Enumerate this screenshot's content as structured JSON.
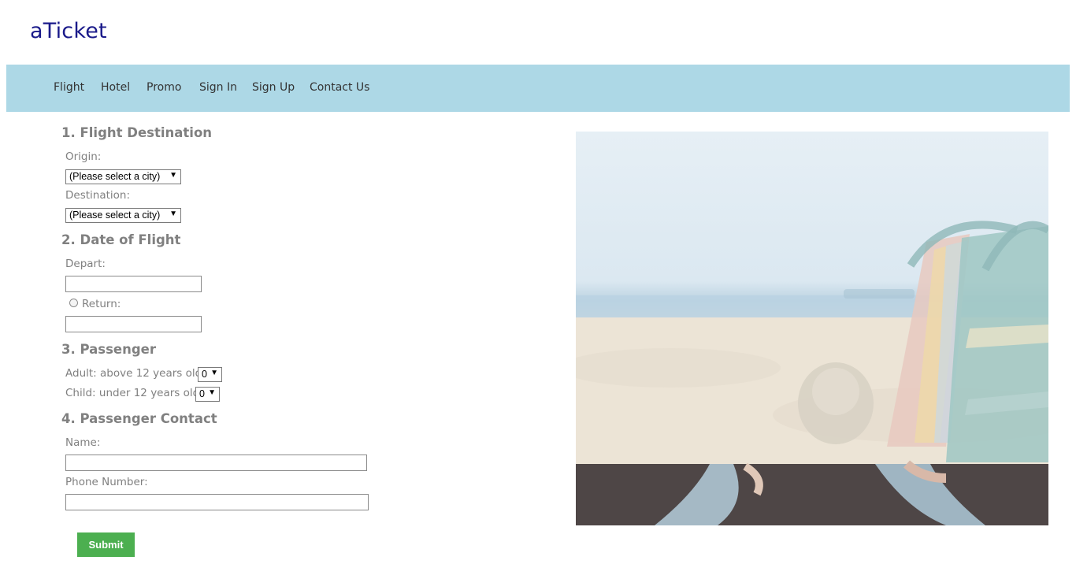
{
  "brand": "aTicket",
  "nav": {
    "items": [
      "Flight",
      "Hotel",
      "Promo",
      "Sign In",
      "Sign Up",
      "Contact Us"
    ]
  },
  "form": {
    "sections": [
      "1. Flight Destination",
      "2. Date of Flight",
      "3. Passenger",
      "4. Passenger Contact"
    ],
    "origin_label": "Origin:",
    "origin_value": "(Please select a city)",
    "destination_label": "Destination:",
    "destination_value": "(Please select a city)",
    "depart_label": "Depart:",
    "depart_value": "",
    "return_label": "Return:",
    "return_value": "",
    "adult_label": "Adult: above 12 years old",
    "adult_value": "0",
    "child_label": "Child: under 12 years old",
    "child_value": "0",
    "name_label": "Name:",
    "name_value": "",
    "phone_label": "Phone Number:",
    "phone_value": "",
    "submit_label": "Submit"
  },
  "colors": {
    "brand": "#1a1a8a",
    "navbar": "#add8e6",
    "section_text": "#808080",
    "submit_bg": "#4caf50"
  },
  "icons": {
    "select_arrow": "dropdown-arrow-icon"
  }
}
